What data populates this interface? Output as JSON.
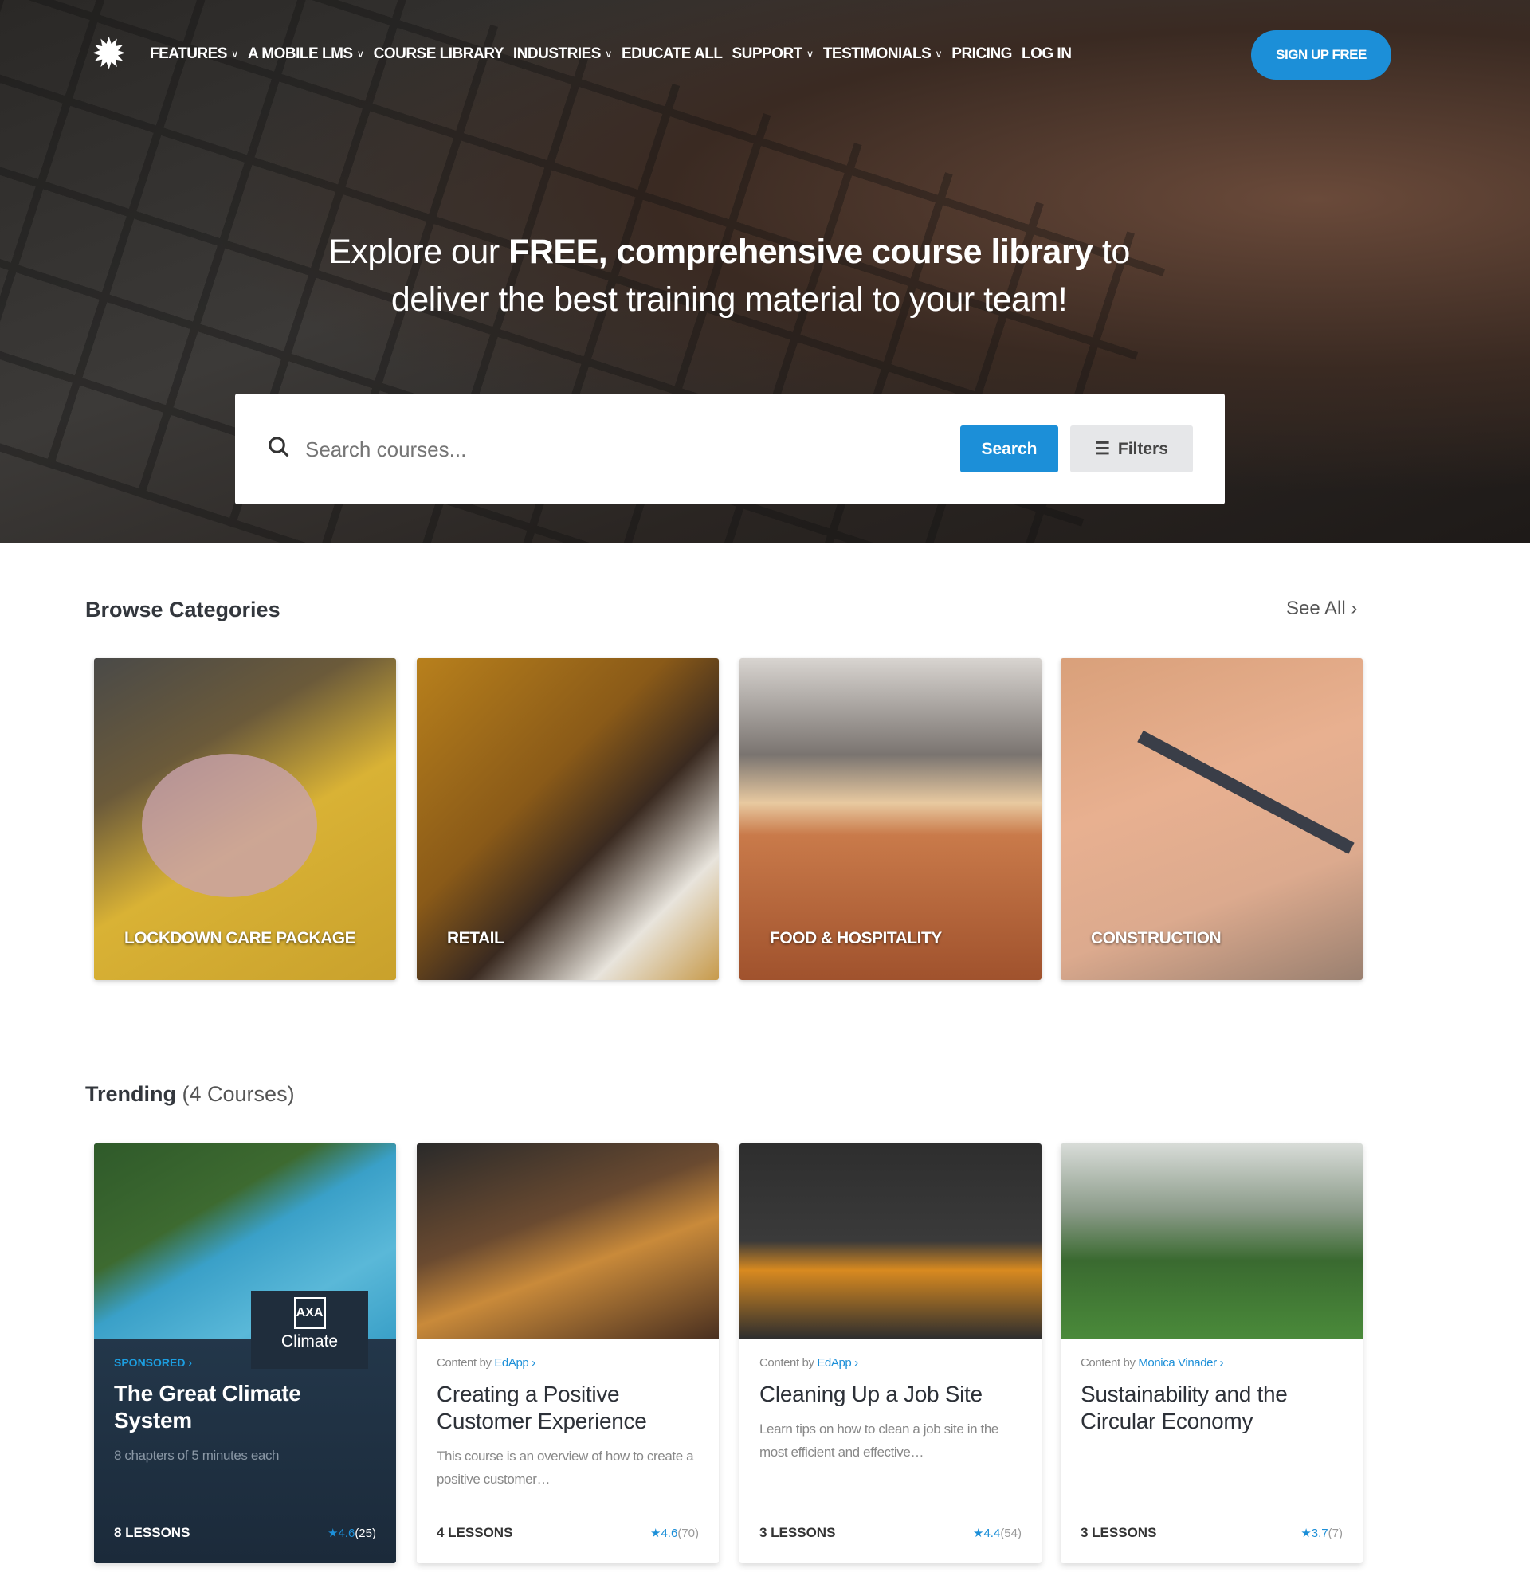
{
  "nav": {
    "items": [
      {
        "label": "FEATURES",
        "dropdown": true
      },
      {
        "label": "A MOBILE LMS",
        "dropdown": true
      },
      {
        "label": "COURSE LIBRARY",
        "dropdown": false
      },
      {
        "label": "INDUSTRIES",
        "dropdown": true
      },
      {
        "label": "EDUCATE ALL",
        "dropdown": false
      },
      {
        "label": "SUPPORT",
        "dropdown": true
      },
      {
        "label": "TESTIMONIALS",
        "dropdown": true
      },
      {
        "label": "PRICING",
        "dropdown": false
      },
      {
        "label": "LOG IN",
        "dropdown": false
      }
    ],
    "signup": "SIGN UP FREE"
  },
  "hero": {
    "pre": "Explore our ",
    "bold": "FREE, comprehensive course library",
    "post": " to",
    "line2": "deliver the best training material to your team!"
  },
  "search": {
    "placeholder": "Search courses...",
    "button": "Search",
    "filters": "Filters"
  },
  "categories": {
    "title": "Browse Categories",
    "see_all": "See All",
    "items": [
      "LOCKDOWN CARE PACKAGE",
      "RETAIL",
      "FOOD & HOSPITALITY",
      "CONSTRUCTION"
    ]
  },
  "trending": {
    "title": "Trending",
    "count": "(4 Courses)",
    "courses": [
      {
        "tag": "SPONSORED",
        "title": "The Great Climate System",
        "desc": "8 chapters of 5 minutes each",
        "lessons": "8 LESSONS",
        "rating": "4.6",
        "count": "(25)",
        "badge": "Climate",
        "badge_logo": "AXA"
      },
      {
        "by": "Content by",
        "provider": "EdApp",
        "title": "Creating a Positive Customer Experience",
        "desc": "This course is an overview of how to create a positive customer…",
        "lessons": "4 LESSONS",
        "rating": "4.6",
        "count": "(70)"
      },
      {
        "by": "Content by",
        "provider": "EdApp",
        "title": "Cleaning Up a Job Site",
        "desc": "Learn tips on how to clean a job site in the most efficient and effective…",
        "lessons": "3 LESSONS",
        "rating": "4.4",
        "count": "(54)"
      },
      {
        "by": "Content by",
        "provider": "Monica Vinader",
        "title": "Sustainability and the Circular Economy",
        "desc": "",
        "lessons": "3 LESSONS",
        "rating": "3.7",
        "count": "(7)"
      }
    ]
  },
  "colors": {
    "accent": "#1c8fd8",
    "sponsored_card": "#1b2a3a"
  }
}
